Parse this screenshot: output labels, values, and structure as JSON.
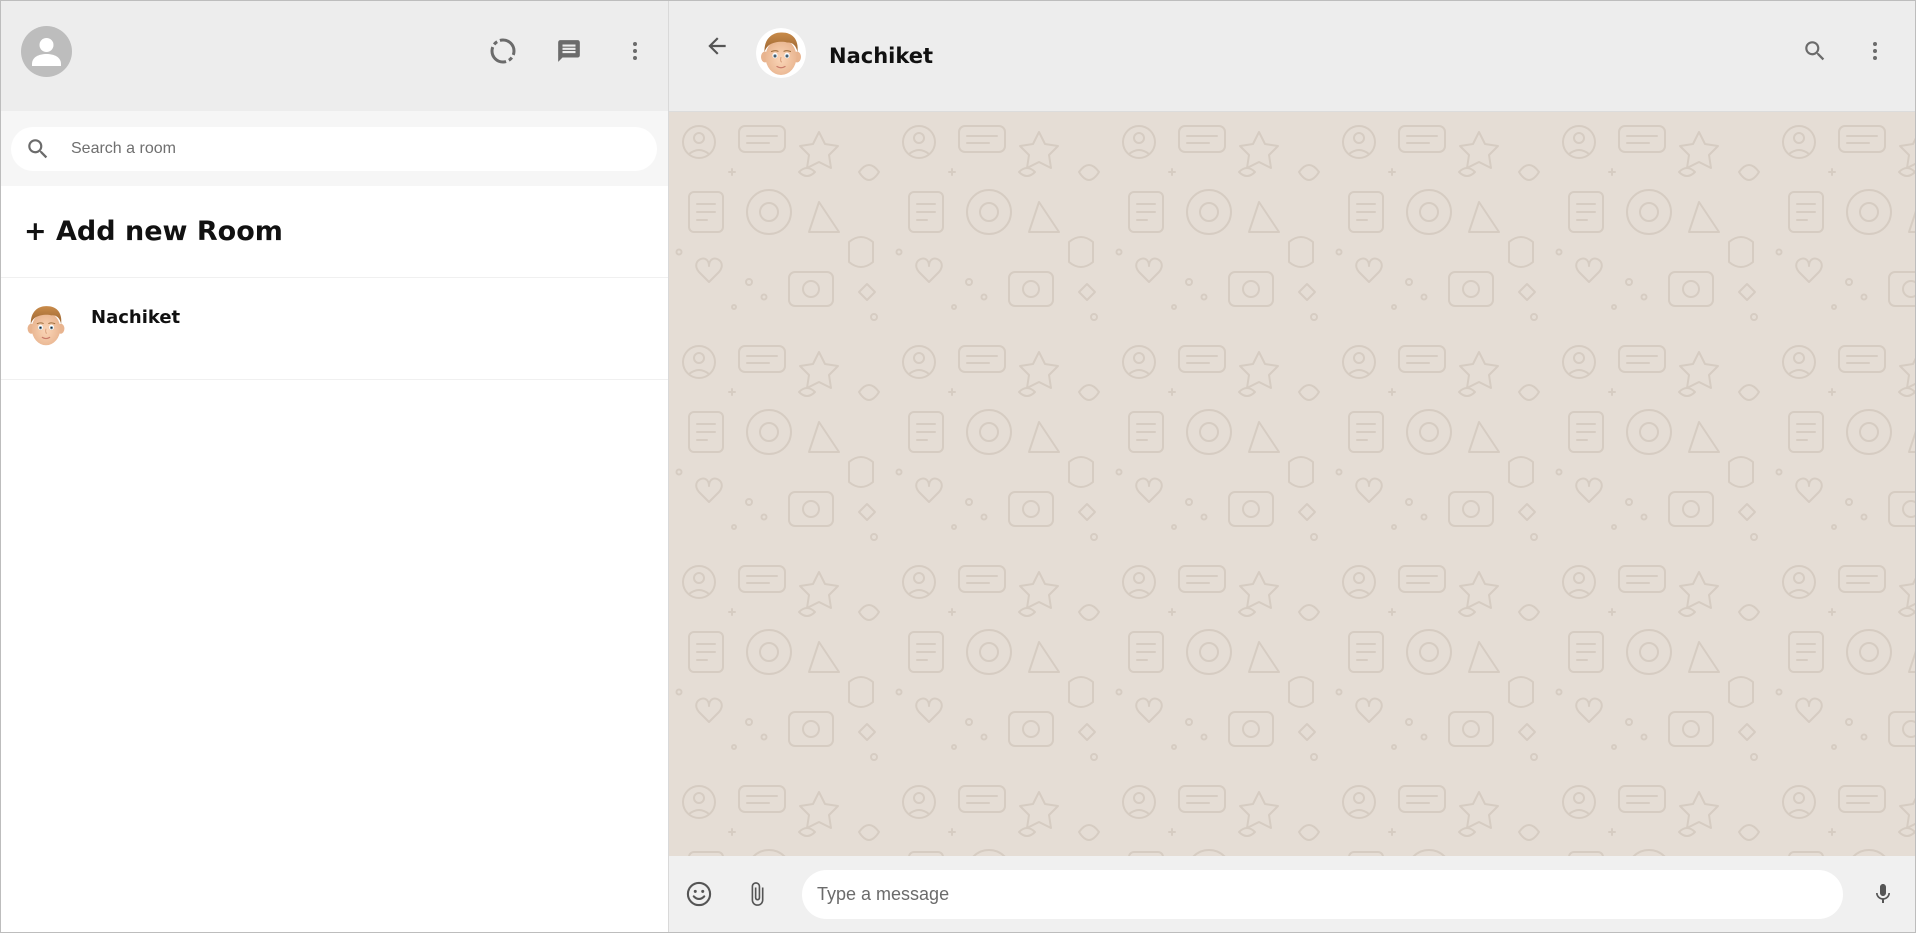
{
  "sidebar": {
    "header": {
      "icons": [
        "person-icon",
        "status-icon",
        "chat-icon",
        "more-vert-icon"
      ]
    },
    "search": {
      "placeholder": "Search a room",
      "value": ""
    },
    "add_room_label": "+ Add new Room",
    "rooms": [
      {
        "name": "Nachiket",
        "avatar": "memoji-avatar"
      }
    ]
  },
  "chat": {
    "header": {
      "title": "Nachiket",
      "icons": [
        "back-arrow-icon",
        "search-icon",
        "more-vert-icon"
      ]
    },
    "footer": {
      "placeholder": "Type a message",
      "value": "",
      "icons": [
        "emoji-icon",
        "attach-icon",
        "mic-icon"
      ]
    }
  },
  "colors": {
    "header_bg": "#ededed",
    "chat_bg": "#e5ddd5",
    "icon": "#6b6b6b",
    "footer_bg": "#f0f0f0"
  }
}
